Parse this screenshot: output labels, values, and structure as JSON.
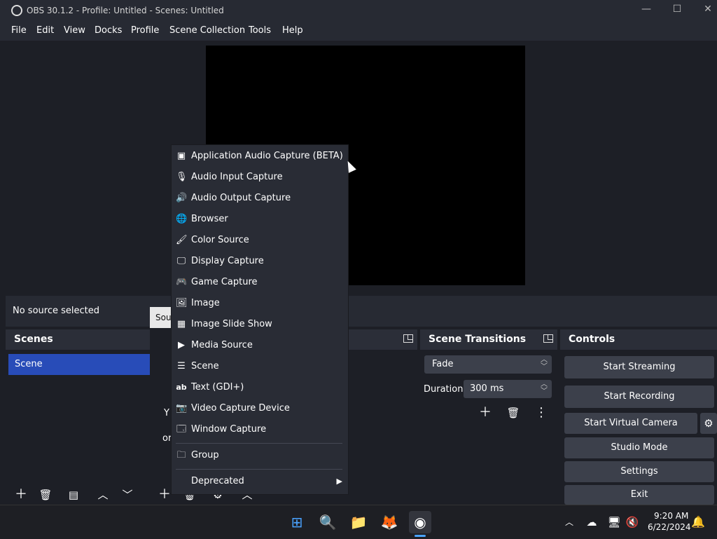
{
  "window": {
    "title": "OBS 30.1.2 - Profile: Untitled - Scenes: Untitled"
  },
  "menu": [
    "File",
    "Edit",
    "View",
    "Docks",
    "Profile",
    "Scene Collection",
    "Tools",
    "Help"
  ],
  "context_bar": {
    "status": "No source selected",
    "tab_label_partial": "Sou"
  },
  "scenes_dock": {
    "title": "Scenes",
    "items": [
      "Scene"
    ]
  },
  "sources_dock": {
    "partial_text_1": "Y",
    "partial_text_2": "or"
  },
  "transitions_dock": {
    "title": "Scene Transitions",
    "transition": "Fade",
    "duration_label": "Duration",
    "duration_value": "300 ms"
  },
  "controls_dock": {
    "title": "Controls",
    "buttons": [
      "Start Streaming",
      "Start Recording",
      "Start Virtual Camera",
      "Studio Mode",
      "Settings",
      "Exit"
    ]
  },
  "context_menu": {
    "items": [
      {
        "label": "Application Audio Capture (BETA)",
        "icon": "app-audio-icon"
      },
      {
        "label": "Audio Input Capture",
        "icon": "microphone-icon"
      },
      {
        "label": "Audio Output Capture",
        "icon": "speaker-icon"
      },
      {
        "label": "Browser",
        "icon": "globe-icon"
      },
      {
        "label": "Color Source",
        "icon": "brush-icon"
      },
      {
        "label": "Display Capture",
        "icon": "monitor-icon"
      },
      {
        "label": "Game Capture",
        "icon": "gamepad-icon"
      },
      {
        "label": "Image",
        "icon": "image-icon"
      },
      {
        "label": "Image Slide Show",
        "icon": "slideshow-icon"
      },
      {
        "label": "Media Source",
        "icon": "play-icon"
      },
      {
        "label": "Scene",
        "icon": "list-icon"
      },
      {
        "label": "Text (GDI+)",
        "icon": "text-icon"
      },
      {
        "label": "Video Capture Device",
        "icon": "camera-icon"
      },
      {
        "label": "Window Capture",
        "icon": "window-icon"
      }
    ],
    "group": {
      "label": "Group",
      "icon": "folder-icon"
    },
    "deprecated": {
      "label": "Deprecated"
    }
  },
  "taskbar": {
    "time": "9:20 AM",
    "date": "6/22/2024"
  },
  "colors": {
    "accent": "#284cb8",
    "menu_bg": "#292c35",
    "panel_bg": "#1d1f26",
    "button_bg": "#3c404b"
  }
}
